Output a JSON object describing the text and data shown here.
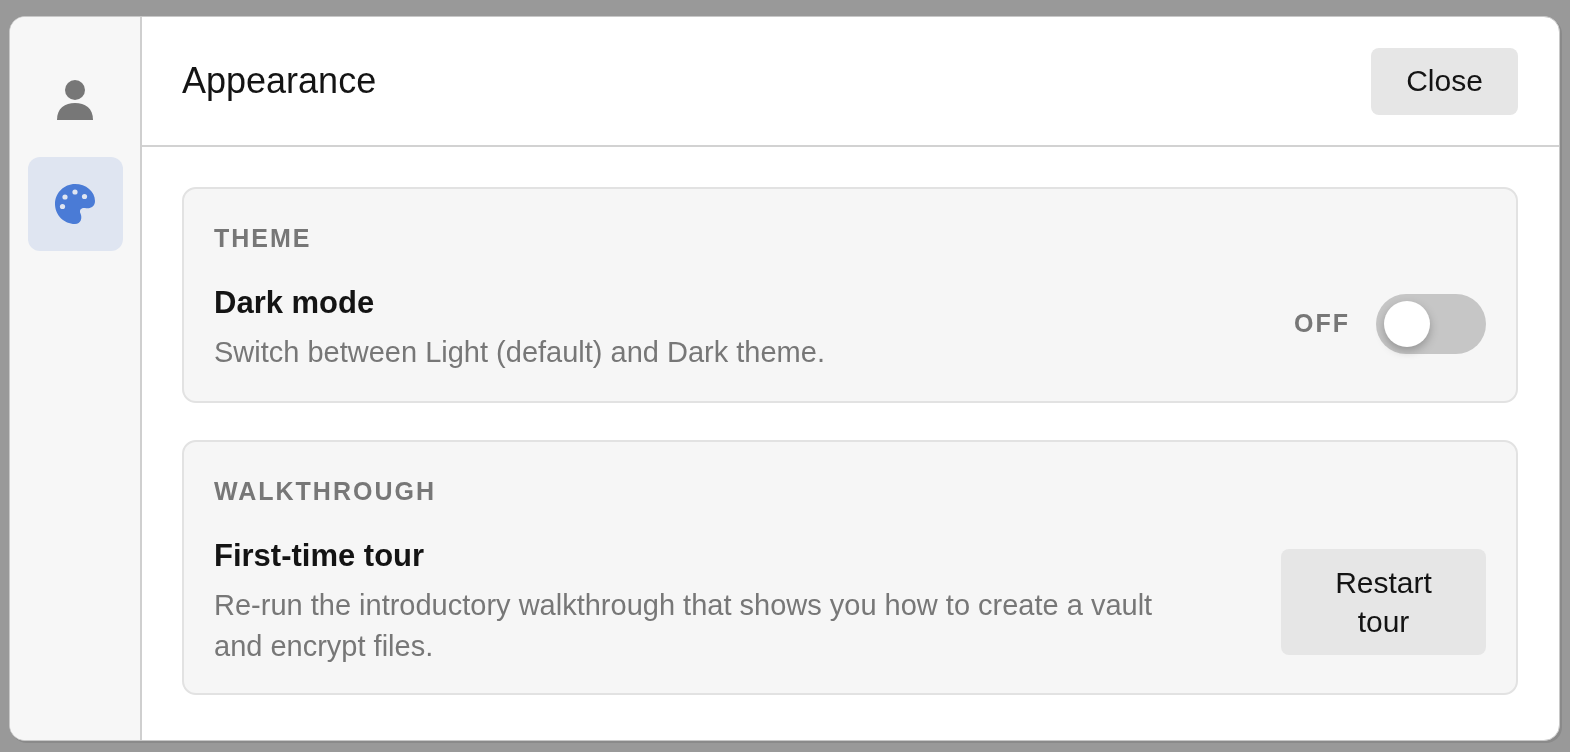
{
  "sidebar": {
    "items": [
      {
        "kind": "profile",
        "selected": false
      },
      {
        "kind": "appearance",
        "selected": true
      }
    ]
  },
  "header": {
    "title": "Appearance",
    "close_button": "Close"
  },
  "sections": [
    {
      "kind": "toggle",
      "heading": "THEME",
      "title": "Dark mode",
      "description": "Switch between Light (default) and Dark theme.",
      "toggle": {
        "state_label": "OFF",
        "on": false
      }
    },
    {
      "kind": "button",
      "heading": "WALKTHROUGH",
      "title": "First-time tour",
      "description": "Re-run the introductory walkthrough that shows you how to create a vault and encrypt files.",
      "button": "Restart tour"
    }
  ]
}
